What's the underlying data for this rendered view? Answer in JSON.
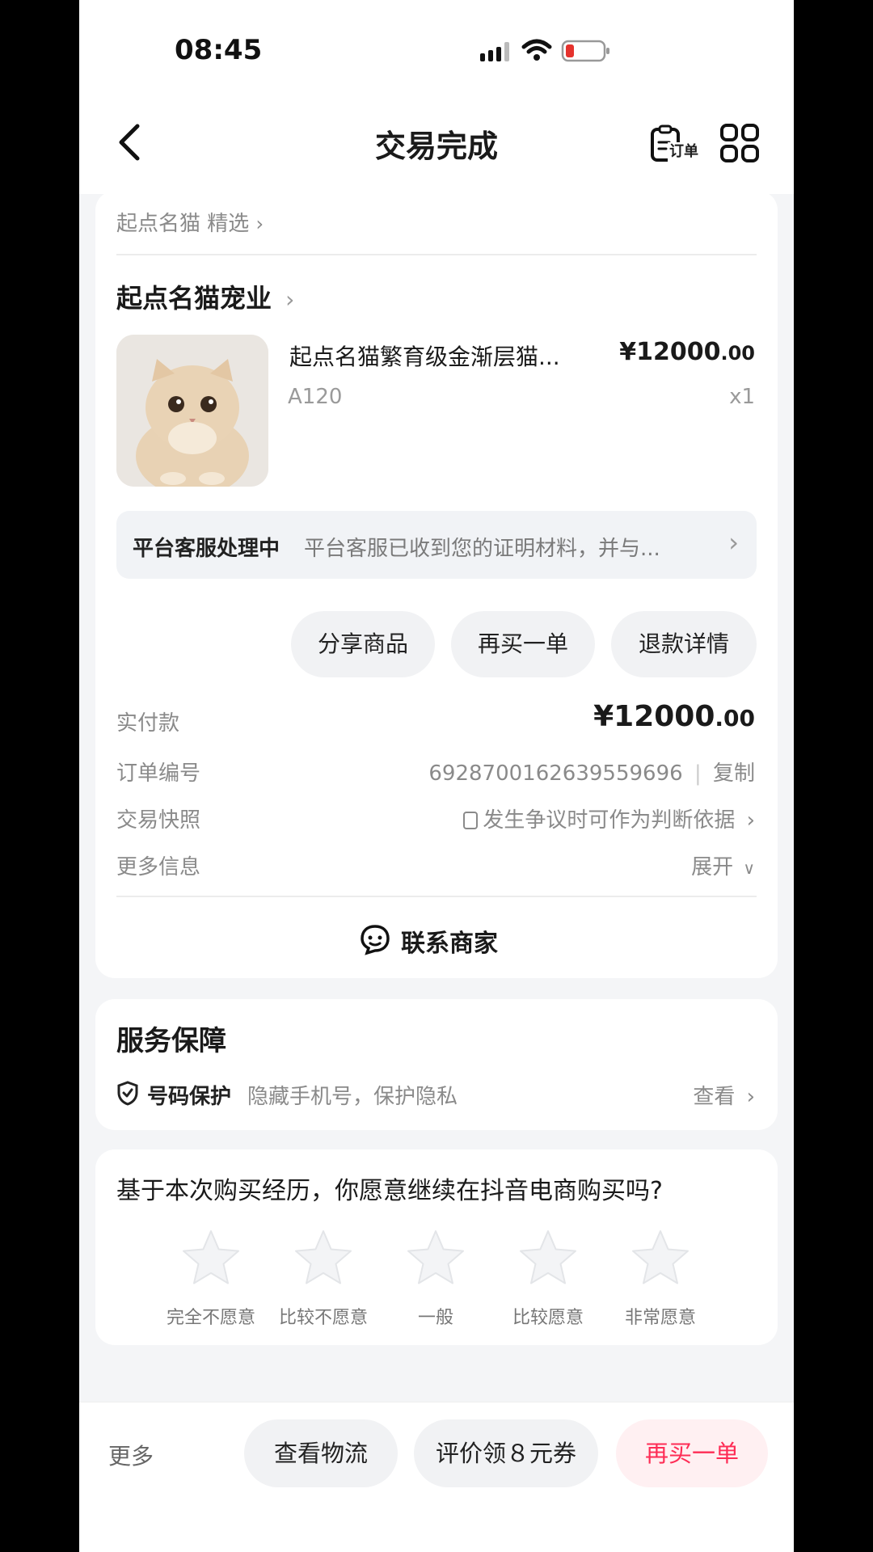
{
  "status_bar": {
    "time": "08:45"
  },
  "nav": {
    "title": "交易完成",
    "order_icon_label": "订单"
  },
  "breadcrumb": {
    "text": "起点名猫 精选"
  },
  "order": {
    "shop_name": "起点名猫宠业",
    "product": {
      "name": "起点名猫繁育级金渐层猫...",
      "sku": "A120",
      "price_main": "¥12000",
      "price_decimal": ".00",
      "qty": "x1"
    },
    "notice": {
      "title": "平台客服处理中",
      "text": "平台客服已收到您的证明材料，并与..."
    },
    "actions": [
      "分享商品",
      "再买一单",
      "退款详情"
    ],
    "paid_label": "实付款",
    "paid_main": "¥12000",
    "paid_decimal": ".00",
    "order_no_label": "订单编号",
    "order_no": "6928700162639559696",
    "copy_label": "复制",
    "snapshot_label": "交易快照",
    "snapshot_value": "发生争议时可作为判断依据",
    "more_info_label": "更多信息",
    "expand_label": "展开",
    "contact_label": "联系商家"
  },
  "service": {
    "title": "服务保障",
    "item_title": "号码保护",
    "item_desc": "隐藏手机号，保护隐私",
    "view_label": "查看"
  },
  "survey": {
    "question": "基于本次购买经历，你愿意继续在抖音电商购买吗?",
    "options": [
      "完全不愿意",
      "比较不愿意",
      "一般",
      "比较愿意",
      "非常愿意"
    ]
  },
  "bottom_bar": {
    "more": "更多",
    "logistics": "查看物流",
    "review_coupon": "评价领８元券",
    "buy_again": "再买一单"
  },
  "colors": {
    "accent_red": "#fe2c55",
    "card_bg": "#ffffff",
    "page_bg": "#f4f5f7"
  }
}
